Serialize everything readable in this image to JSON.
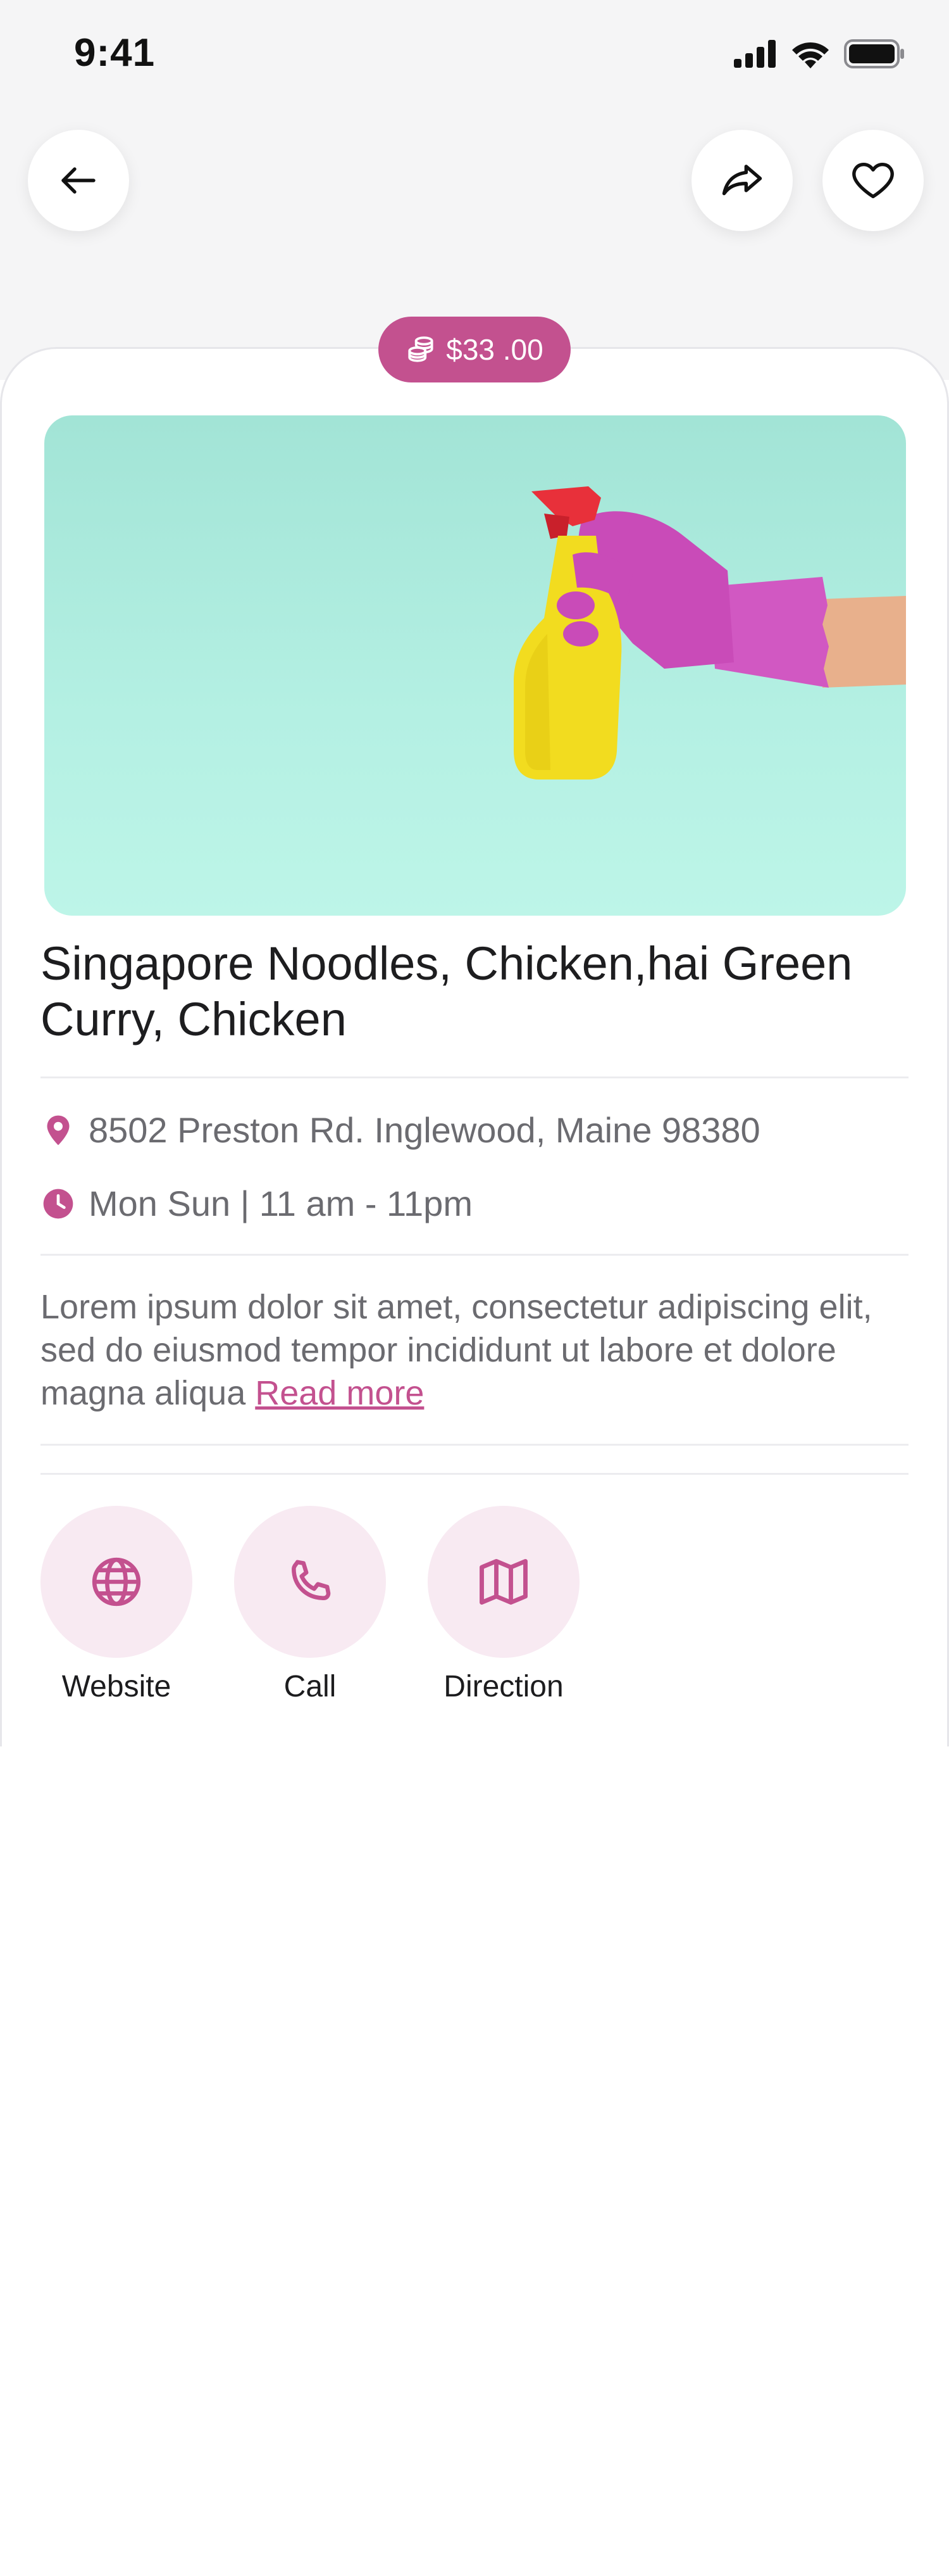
{
  "status_bar": {
    "time": "9:41",
    "icons": [
      "cellular-signal-icon",
      "wifi-icon",
      "battery-icon"
    ]
  },
  "header": {
    "back_icon": "arrow-left-icon",
    "share_icon": "share-icon",
    "favorite_icon": "heart-icon"
  },
  "price": {
    "icon": "coins-icon",
    "label": "$33 .00"
  },
  "product": {
    "image": "spray-bottle-photo",
    "title": "Singapore Noodles, Chicken,hai Green Curry, Chicken",
    "address": "8502 Preston Rd. Inglewood, Maine 98380",
    "hours": "Mon Sun | 11 am - 11pm",
    "description": "Lorem ipsum dolor sit amet, consectetur adipiscing elit, sed do eiusmod tempor incididunt ut labore et dolore magna aliqua",
    "read_more": "Read more"
  },
  "actions": [
    {
      "label": "Website",
      "icon": "globe-icon"
    },
    {
      "label": "Call",
      "icon": "phone-icon"
    },
    {
      "label": "Direction",
      "icon": "map-icon"
    }
  ],
  "colors": {
    "accent": "#c3518f",
    "accent_light": "#f8eaf2",
    "image_bg": "#a2e4d6"
  }
}
